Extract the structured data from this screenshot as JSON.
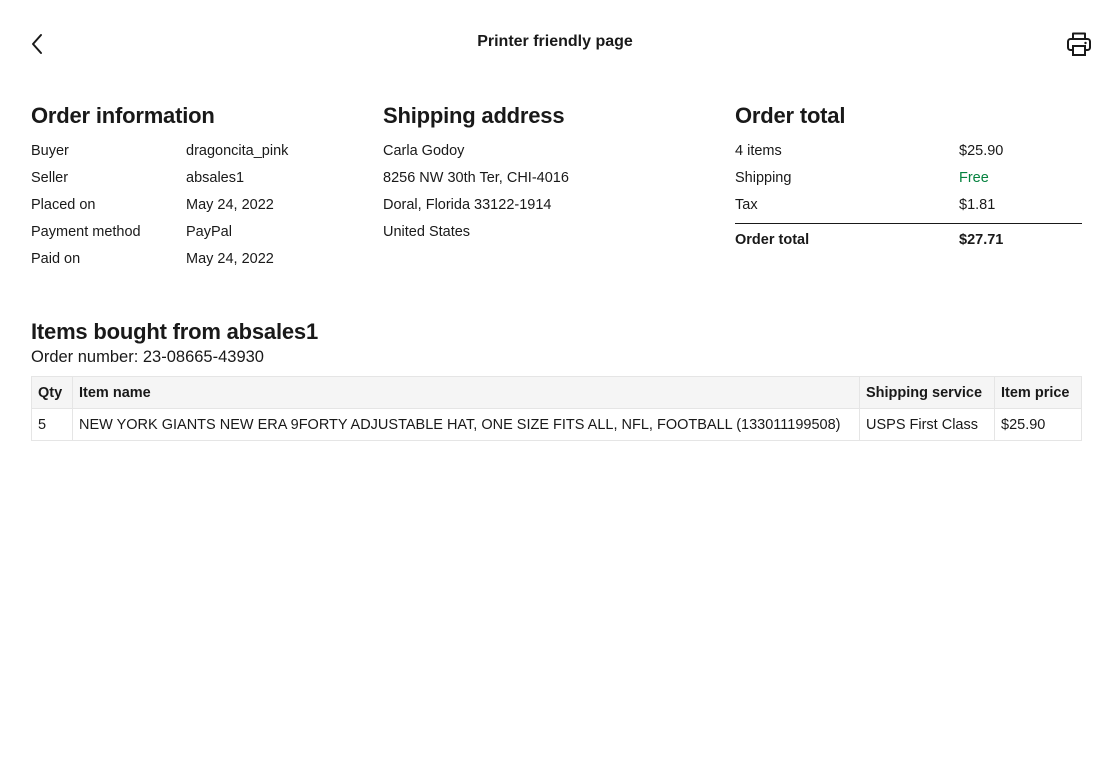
{
  "header": {
    "title": "Printer friendly page",
    "back_icon": "chevron-left-icon",
    "print_icon": "printer-icon"
  },
  "order_info": {
    "title": "Order information",
    "rows": [
      {
        "label": "Buyer",
        "value": "dragoncita_pink"
      },
      {
        "label": "Seller",
        "value": "absales1"
      },
      {
        "label": "Placed on",
        "value": "May 24, 2022"
      },
      {
        "label": "Payment method",
        "value": "PayPal"
      },
      {
        "label": "Paid on",
        "value": "May 24, 2022"
      }
    ]
  },
  "shipping_address": {
    "title": "Shipping address",
    "lines": [
      "Carla Godoy",
      "8256 NW 30th Ter, CHI-4016",
      "Doral, Florida 33122-1914",
      "United States"
    ]
  },
  "order_total": {
    "title": "Order total",
    "rows": [
      {
        "label": "4 items",
        "value": "$25.90"
      },
      {
        "label": "Shipping",
        "value": "Free"
      },
      {
        "label": "Tax",
        "value": "$1.81"
      }
    ],
    "total": {
      "label": "Order total",
      "value": "$27.71"
    }
  },
  "items": {
    "title": "Items bought from absales1",
    "order_number": "Order number: 23-08665-43930",
    "columns": [
      "Qty",
      "Item name",
      "Shipping service",
      "Item price"
    ],
    "rows": [
      {
        "qty": "5",
        "name": "NEW YORK GIANTS NEW ERA 9FORTY ADJUSTABLE HAT, ONE SIZE FITS ALL, NFL, FOOTBALL (133011199508)",
        "shipping": "USPS First Class",
        "price": "$25.90"
      }
    ]
  },
  "colors": {
    "text": "#191919",
    "free_green": "#05823f",
    "table_header_bg": "#f5f5f5",
    "table_border": "#e5e5e5"
  }
}
